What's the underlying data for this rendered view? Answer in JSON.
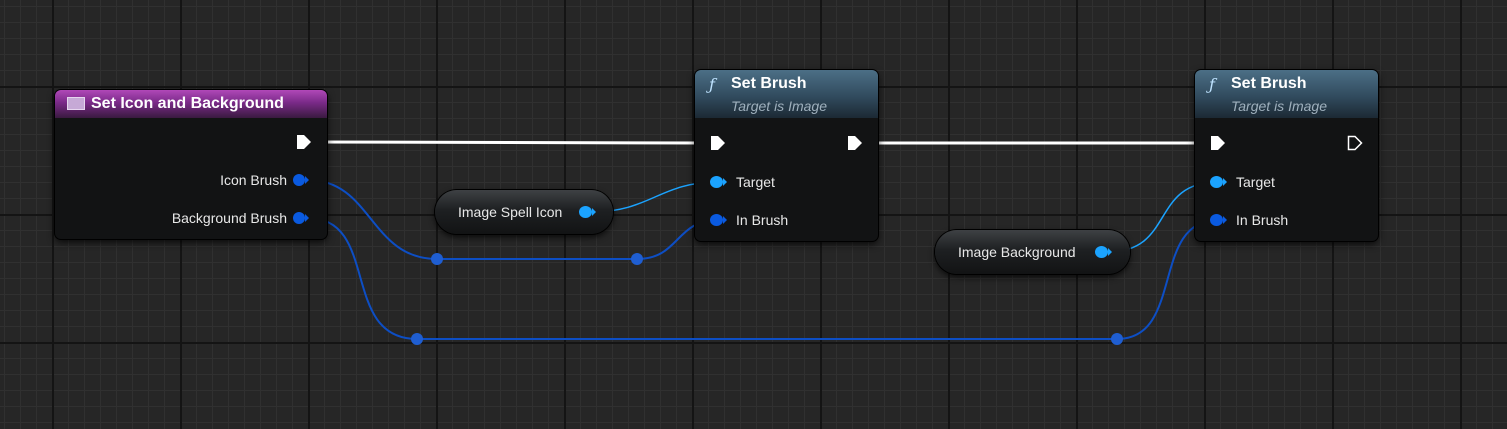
{
  "graph": {
    "nodes": {
      "event": {
        "title": "Set Icon and Background",
        "pins": {
          "icon_brush": "Icon Brush",
          "background_brush": "Background Brush"
        }
      },
      "set_brush_1": {
        "title": "Set Brush",
        "subtitle": "Target is Image",
        "pins": {
          "target": "Target",
          "in_brush": "In Brush"
        }
      },
      "set_brush_2": {
        "title": "Set Brush",
        "subtitle": "Target is Image",
        "pins": {
          "target": "Target",
          "in_brush": "In Brush"
        }
      },
      "var_spell_icon": {
        "label": "Image Spell Icon"
      },
      "var_background": {
        "label": "Image Background"
      }
    },
    "icons": {
      "function": "ƒ",
      "event": "event-icon"
    },
    "colors": {
      "exec_wire": "#ffffff",
      "object_pin": "#1ba3ff",
      "struct_pin": "#0a5ae0",
      "struct_wire": "#0d4ec4",
      "event_header": "#8a2e98",
      "function_header": "#3d5c72"
    }
  }
}
